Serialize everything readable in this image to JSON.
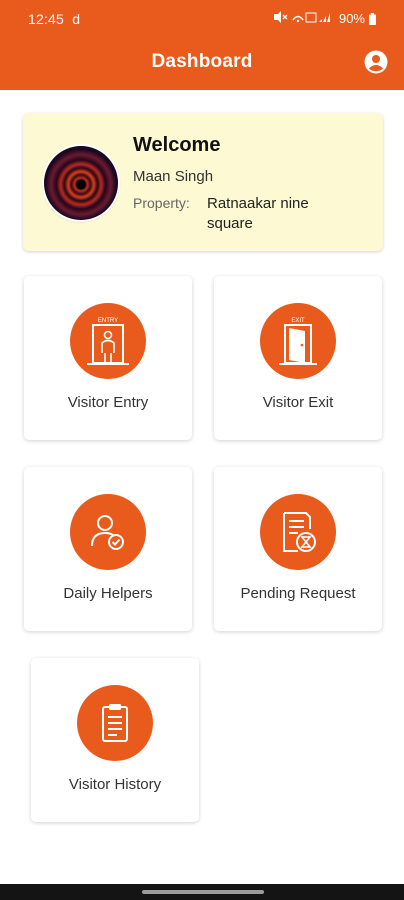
{
  "status_bar": {
    "time": "12:45",
    "carrier_glyph": "d",
    "battery": "90%"
  },
  "app_bar": {
    "title": "Dashboard",
    "account_icon": "account-circle-icon"
  },
  "welcome_card": {
    "title": "Welcome",
    "user_name": "Maan Singh",
    "property_label": "Property:",
    "property_value": "Ratnaakar nine square"
  },
  "tiles": [
    {
      "label": "Visitor Entry",
      "icon": "entry-door-icon",
      "icon_caption": "ENTRY"
    },
    {
      "label": "Visitor Exit",
      "icon": "exit-door-icon",
      "icon_caption": "EXIT"
    },
    {
      "label": "Daily Helpers",
      "icon": "helper-person-icon"
    },
    {
      "label": "Pending Request",
      "icon": "pending-document-icon"
    },
    {
      "label": "Visitor History",
      "icon": "clipboard-history-icon"
    }
  ],
  "colors": {
    "primary": "#e85b1c",
    "welcome_bg": "#fdf9d3"
  }
}
